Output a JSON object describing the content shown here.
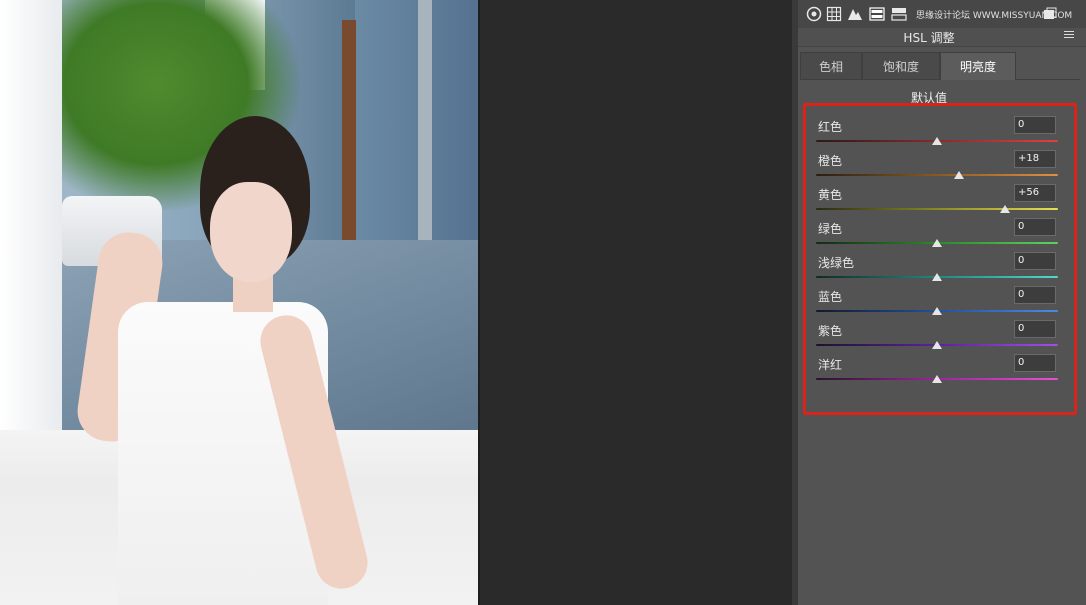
{
  "panel": {
    "title": "HSL 调整",
    "watermark": "思缘设计论坛 WWW.MISSYUAN.COM",
    "tabs": [
      {
        "label": "色相",
        "active": false
      },
      {
        "label": "饱和度",
        "active": false
      },
      {
        "label": "明亮度",
        "active": true
      }
    ],
    "default_link": "默认值",
    "toolbar_icons": [
      "aperture-icon",
      "grid-icon",
      "mountain-icon",
      "hsl-icon",
      "split-tone-icon",
      "lens-icon",
      "fx-icon",
      "camera-icon",
      "presets-icon",
      "snapshot-icon"
    ],
    "highlight_color": "#d9241c",
    "sliders": [
      {
        "label": "红色",
        "value": "0",
        "level": 0,
        "track": [
          "#2a1a1a",
          "#8a2a2a",
          "#e04040"
        ]
      },
      {
        "label": "橙色",
        "value": "+18",
        "level": 18,
        "track": [
          "#2a1e12",
          "#8a5a22",
          "#e09040"
        ]
      },
      {
        "label": "黄色",
        "value": "+56",
        "level": 56,
        "track": [
          "#2a2a12",
          "#8a8a22",
          "#e6e050"
        ]
      },
      {
        "label": "绿色",
        "value": "0",
        "level": 0,
        "track": [
          "#142a14",
          "#2a8a2a",
          "#60d060"
        ]
      },
      {
        "label": "浅绿色",
        "value": "0",
        "level": 0,
        "track": [
          "#122a26",
          "#1e8a80",
          "#50d8c8"
        ]
      },
      {
        "label": "蓝色",
        "value": "0",
        "level": 0,
        "track": [
          "#121a2a",
          "#2250a0",
          "#4a8ae6"
        ]
      },
      {
        "label": "紫色",
        "value": "0",
        "level": 0,
        "track": [
          "#1e122a",
          "#5a22a0",
          "#a050e6"
        ]
      },
      {
        "label": "洋红",
        "value": "0",
        "level": 0,
        "track": [
          "#2a122a",
          "#a022a0",
          "#e650d8"
        ]
      }
    ]
  }
}
